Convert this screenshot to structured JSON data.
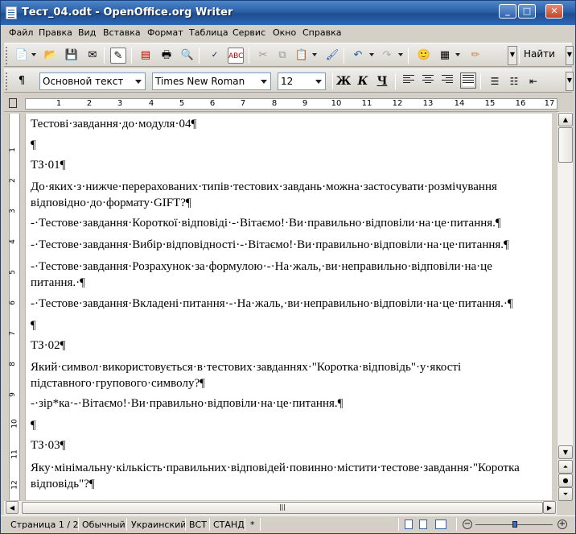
{
  "window": {
    "title": "Тест_04.odt - OpenOffice.org Writer"
  },
  "menu": [
    "Файл",
    "Правка",
    "Вид",
    "Вставка",
    "Формат",
    "Таблица",
    "Сервис",
    "Окно",
    "Справка"
  ],
  "toolbar": {
    "find_label": "Найти"
  },
  "format": {
    "style": "Основной текст",
    "font": "Times New Roman",
    "size": "12",
    "bold": "Ж",
    "italic": "К",
    "underline": "Ч"
  },
  "ruler": {
    "numbers": [
      "1",
      "2",
      "3",
      "4",
      "5",
      "6",
      "7",
      "8",
      "9",
      "10",
      "11",
      "12",
      "13",
      "14",
      "15",
      "16",
      "17"
    ]
  },
  "vruler": {
    "numbers": [
      "1",
      "2",
      "3",
      "4",
      "5",
      "6",
      "7",
      "8",
      "9",
      "10",
      "11",
      "12"
    ]
  },
  "document": {
    "paragraphs": [
      "Тестові·завдання·до·модуля·04¶",
      "¶",
      "ТЗ·01¶",
      "До·яких·з·нижче·перерахованих·типів·тестових·завдань·можна·застосувати·розмічування",
      "відповідно·до·формату·GIFT?¶",
      "-·Тестове·завдання·Короткої·відповіді·-·Вітаємо!·Ви·правильно·відповіли·на·це·питання.¶",
      "-·Тестове·завдання·Вибір·відповідності·-·Вітаємо!·Ви·правильно·відповіли·на·це·питання.¶",
      "-·Тестове·завдання·Розрахунок·за·формулою·-·На·жаль,·ви·неправильно·відповіли·на·це",
      "питання.·¶",
      "-·Тестове·завдання·Вкладені·питання·-·На·жаль,·ви·неправильно·відповіли·на·це·питання.·¶",
      "¶",
      "ТЗ·02¶",
      "Який·символ·використовується·в·тестових·завданнях·\"Коротка·відповідь\"·у·якості",
      "підставного·групового·символу?¶",
      "-·зір*ка·-·Вітаємо!·Ви·правильно·відповіли·на·це·питання.¶",
      "¶",
      "ТЗ·03¶",
      "Яку·мінімальну·кількість·правильних·відповідей·повинно·містити·тестове·завдання·\"Коротка",
      "відповідь\"?¶"
    ]
  },
  "status": {
    "page": "Страница  1 / 2",
    "style": "Обычный",
    "language": "Украинский",
    "insert": "ВСТ",
    "selection": "СТАНД",
    "modified": "*"
  }
}
